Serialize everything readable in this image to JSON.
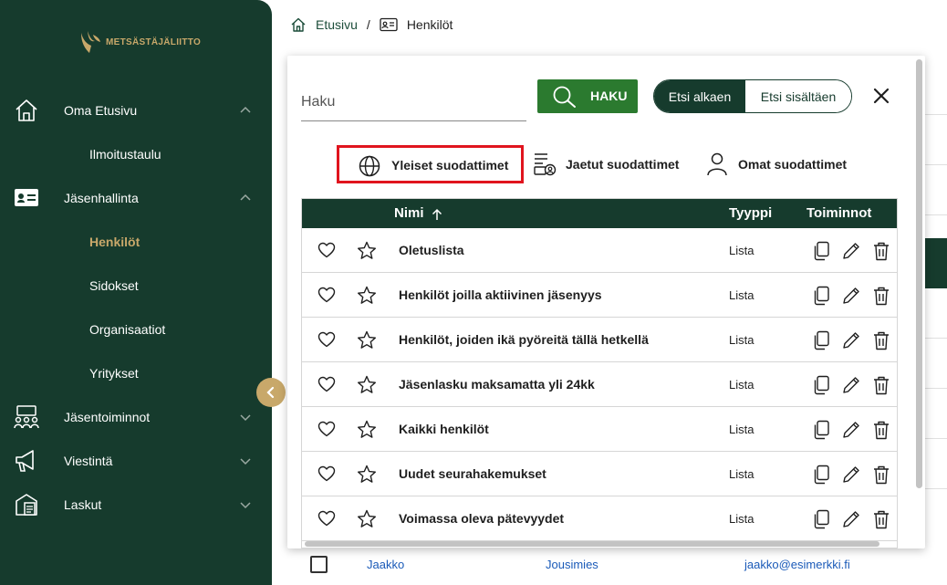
{
  "brand": {
    "logo_text": "METSÄSTÄJÄLIITTO",
    "accent": "#c8a86a",
    "sidebar_bg": "#163b2d"
  },
  "sidebar": {
    "items": [
      {
        "label": "Oma Etusivu",
        "icon": "home-icon",
        "expanded": true
      },
      {
        "label": "Jäsenhallinta",
        "icon": "id-card-icon",
        "expanded": true
      },
      {
        "label": "Jäsentoiminnot",
        "icon": "group-icon",
        "expanded": false
      },
      {
        "label": "Viestintä",
        "icon": "megaphone-icon",
        "expanded": false
      },
      {
        "label": "Laskut",
        "icon": "invoice-icon",
        "expanded": false
      }
    ],
    "subitems": [
      "Ilmoitustaulu",
      "Henkilöt",
      "Sidokset",
      "Organisaatiot",
      "Yritykset"
    ],
    "active_subitem": "Henkilöt"
  },
  "breadcrumb": {
    "home": "Etusivu",
    "separator": "/",
    "current": "Henkilöt"
  },
  "modal": {
    "search_placeholder": "Haku",
    "search_button": "HAKU",
    "mode_options": [
      "Etsi alkaen",
      "Etsi sisältäen"
    ],
    "mode_selected": "Etsi alkaen",
    "filter_tabs": [
      "Yleiset suodattimet",
      "Jaetut suodattimet",
      "Omat suodattimet"
    ],
    "active_filter_tab": "Yleiset suodattimet"
  },
  "table": {
    "columns": {
      "name": "Nimi",
      "type": "Tyyppi",
      "actions": "Toiminnot"
    },
    "sort": "Nimi ascending",
    "rows": [
      {
        "name": "Oletuslista",
        "type": "Lista"
      },
      {
        "name": "Henkilöt joilla aktiivinen jäsenyys",
        "type": "Lista"
      },
      {
        "name": "Henkilöt, joiden ikä pyöreitä tällä hetkellä",
        "type": "Lista"
      },
      {
        "name": "Jäsenlasku maksamatta yli 24kk",
        "type": "Lista"
      },
      {
        "name": "Kaikki henkilöt",
        "type": "Lista"
      },
      {
        "name": "Uudet seurahakemukset",
        "type": "Lista"
      },
      {
        "name": "Voimassa oleva pätevyydet",
        "type": "Lista"
      }
    ]
  },
  "background_row": {
    "first_name": "Jaakko",
    "last_name": "Jousimies",
    "email": "jaakko@esimerkki.fi"
  }
}
